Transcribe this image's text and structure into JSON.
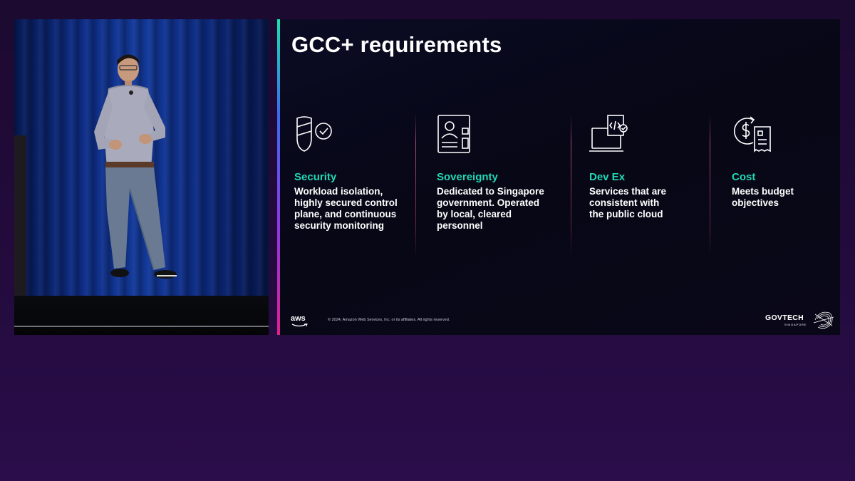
{
  "slide": {
    "title": "GCC+ requirements",
    "columns": [
      {
        "icon": "shield-check-icon",
        "heading": "Security",
        "lines": [
          "Workload isolation,",
          "highly secured control",
          "plane, and continuous",
          "security monitoring"
        ]
      },
      {
        "icon": "id-card-icon",
        "heading": "Sovereignty",
        "lines": [
          "Dedicated to Singapore",
          "government. Operated",
          "by local, cleared",
          "personnel"
        ]
      },
      {
        "icon": "laptop-code-icon",
        "heading": "Dev Ex",
        "lines": [
          "Services that are",
          "consistent with",
          "the public cloud"
        ]
      },
      {
        "icon": "cost-receipt-icon",
        "heading": "Cost",
        "lines": [
          "Meets budget",
          "objectives"
        ]
      }
    ],
    "footer": {
      "aws_logo": "aws",
      "copyright": "© 2024, Amazon Web Services, Inc. or its affiliates. All rights reserved.",
      "partner_logo": "GOVTECH",
      "partner_sub": "SINGAPORE"
    }
  },
  "colors": {
    "accent_heading": "#21d8b5",
    "title_text": "#ffffff",
    "slide_bg": "#07071a",
    "page_bg": "#230b3d"
  }
}
